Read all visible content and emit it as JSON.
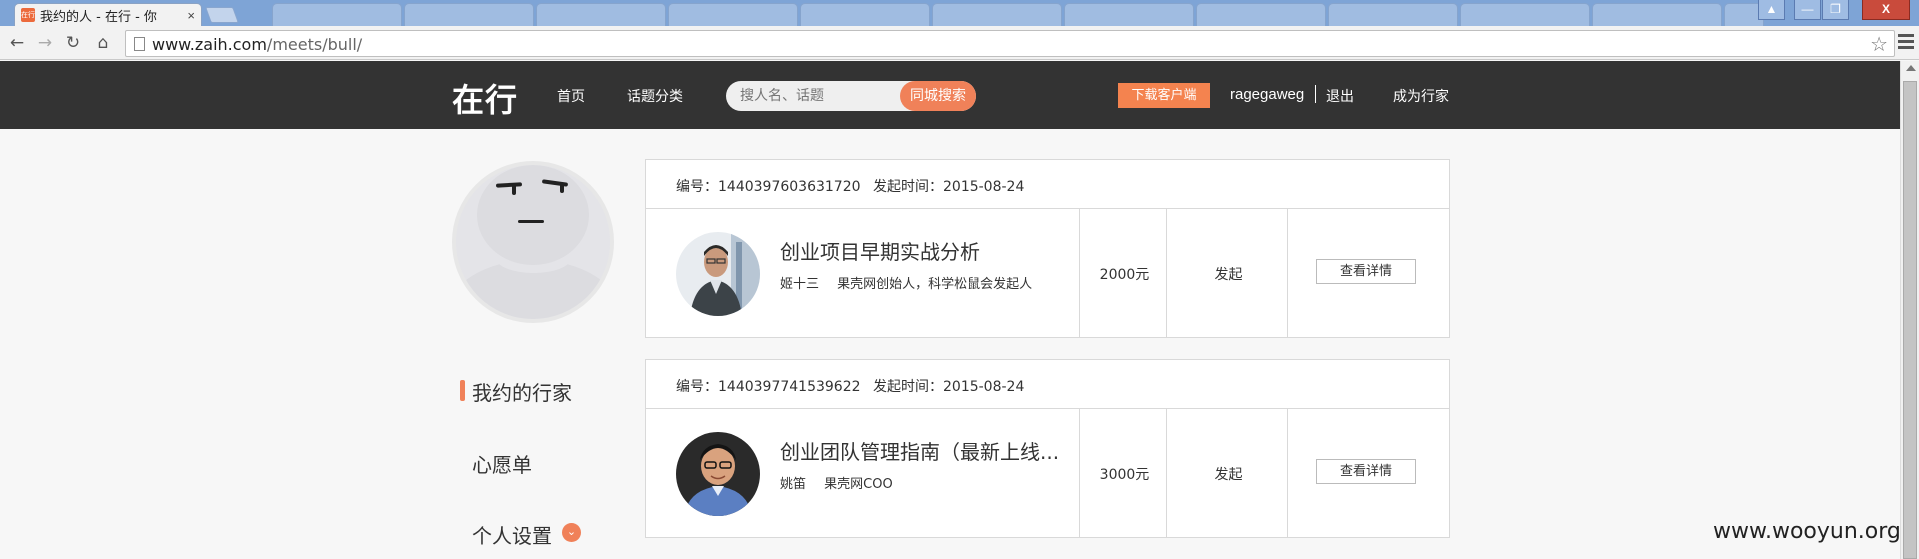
{
  "browser": {
    "active_tab": {
      "title": "我约的人 - 在行 - 你",
      "favicon_text": "在行",
      "close": "×"
    },
    "address": {
      "host": "www.zaih.com",
      "path": "/meets/bull/"
    },
    "nav": {
      "back": "←",
      "forward": "→",
      "reload": "↻",
      "home": "⌂"
    },
    "star": "☆",
    "window_buttons": {
      "minimize": "—",
      "maximize": "❐",
      "close": "X",
      "profile": "▲"
    }
  },
  "header": {
    "logo": "在行",
    "nav_home": "首页",
    "nav_topics": "话题分类",
    "search_placeholder": "搜人名、话题",
    "search_button": "同城搜索",
    "download": "下载客户端",
    "username": "ragegaweg",
    "logout": "退出",
    "become_expert": "成为行家"
  },
  "sidebar": {
    "items": [
      {
        "label": "我约的行家"
      },
      {
        "label": "心愿单"
      },
      {
        "label": "个人设置"
      }
    ],
    "settings_badge": "⌄"
  },
  "orders": [
    {
      "order_no": "编号：1440397603631720",
      "date": "发起时间：2015-08-24",
      "title": "创业项目早期实战分析",
      "expert_name": "姬十三",
      "expert_desc": "果壳网创始人，科学松鼠会发起人",
      "price": "2000元",
      "status": "发起",
      "action": "查看详情"
    },
    {
      "order_no": "编号：1440397741539622",
      "date": "发起时间：2015-08-24",
      "title": "创业团队管理指南（最新上线...",
      "expert_name": "姚笛",
      "expert_desc": "果壳网COO",
      "price": "3000元",
      "status": "发起",
      "action": "查看详情"
    }
  ],
  "watermark": "www.wooyun.org"
}
